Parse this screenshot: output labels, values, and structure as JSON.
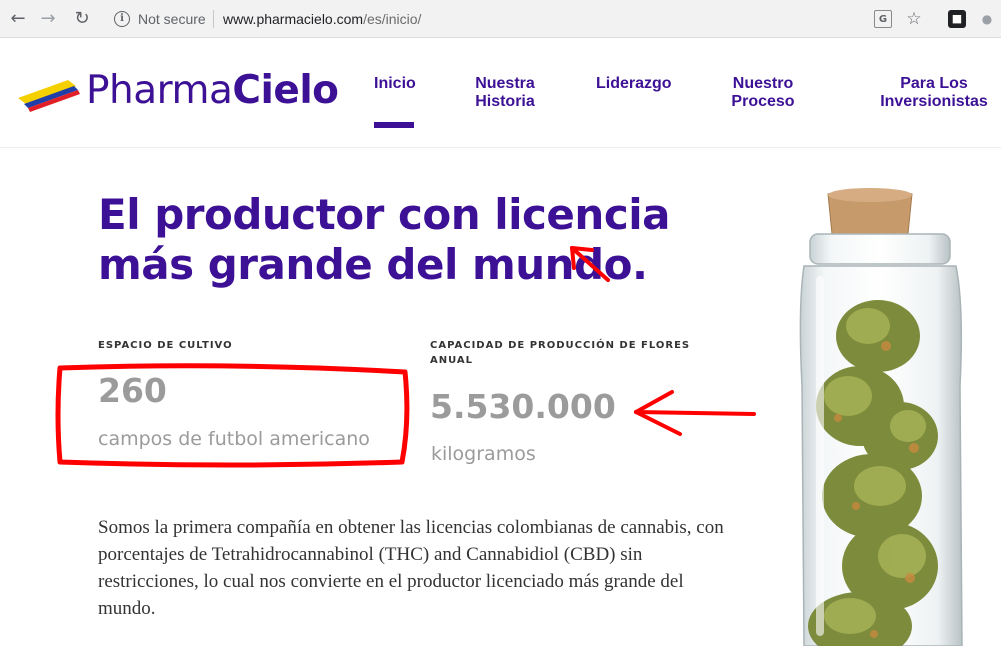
{
  "browser": {
    "security_text": "Not secure",
    "url_domain": "www.pharmacielo.com",
    "url_path": "/es/inicio/"
  },
  "brand": {
    "name_regular": "Pharma",
    "name_bold": "Cielo",
    "primary_color": "#3d1196",
    "flag_colors": [
      "#f5d000",
      "#1f3ea8",
      "#e01f26"
    ]
  },
  "nav": {
    "items": [
      {
        "label": "Inicio",
        "active": true
      },
      {
        "label": "Nuestra Historia"
      },
      {
        "label": "Liderazgo"
      },
      {
        "label": "Nuestro Proceso"
      },
      {
        "label": "Para Los Inversionistas"
      }
    ]
  },
  "hero": {
    "headline": "El productor con licencia más grande del mundo."
  },
  "stats": [
    {
      "label": "ESPACIO DE CULTIVO",
      "value": "260",
      "unit": "campos de futbol americano"
    },
    {
      "label": "CAPACIDAD DE PRODUCCIÓN DE FLORES ANUAL",
      "value": "5.530.000",
      "unit": "kilogramos"
    }
  ],
  "body": {
    "paragraph": "Somos la primera compañía en obtener las licencias colombianas de cannabis, con porcentajes de Tetrahidrocannabinol  (THC) and Cannabidiol (CBD) sin restricciones, lo cual nos convierte en el productor licenciado  más grande del mundo."
  },
  "annotation_color": "#ff0000"
}
